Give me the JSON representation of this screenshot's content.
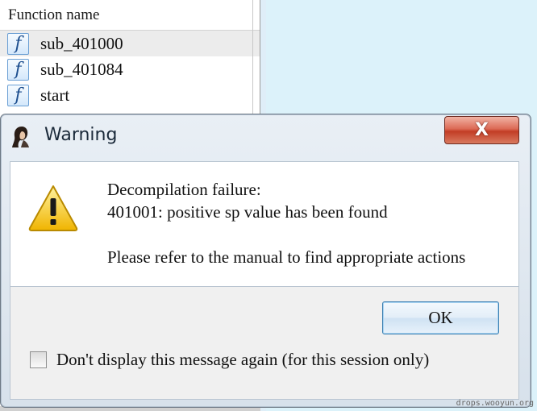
{
  "function_list": {
    "header": "Function name",
    "items": [
      {
        "icon": "function-icon",
        "glyph": "f",
        "label": "sub_401000",
        "selected": true
      },
      {
        "icon": "function-icon",
        "glyph": "f",
        "label": "sub_401084",
        "selected": false
      },
      {
        "icon": "function-icon",
        "glyph": "f",
        "label": "start",
        "selected": false
      }
    ]
  },
  "dialog": {
    "title": "Warning",
    "close_label": "X",
    "message_line1": "Decompilation failure:",
    "message_line2": "401001: positive sp value has been found",
    "message_line3": "Please refer to the manual to find appropriate actions",
    "ok_label": "OK",
    "checkbox_label": "Don't display this message again (for this session only)",
    "checkbox_checked": false
  },
  "watermark": "drops.wooyun.org",
  "colors": {
    "close_button": "#c23c25",
    "warning_yellow": "#f5c518",
    "ok_border": "#3c7fb1",
    "function_icon_blue": "#1d4f8f"
  }
}
